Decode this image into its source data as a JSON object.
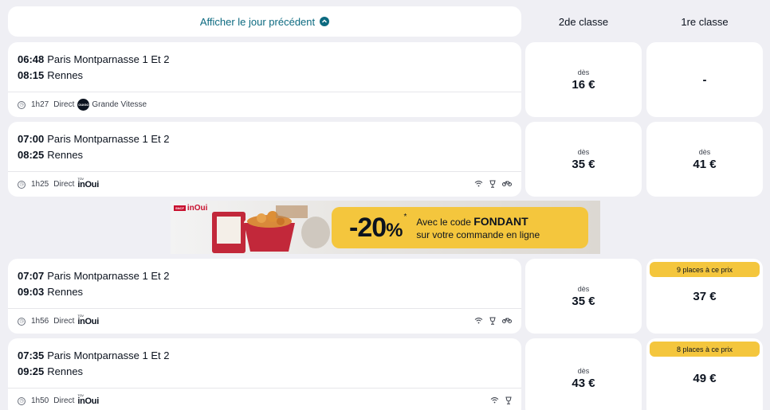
{
  "prev_day": {
    "label": "Afficher le jour précédent"
  },
  "headers": {
    "second_class": "2de classe",
    "first_class": "1re classe"
  },
  "journeys": [
    {
      "dep_time": "06:48",
      "dep_station": "Paris Montparnasse 1 Et 2",
      "arr_time": "08:15",
      "arr_station": "Rennes",
      "duration": "1h27",
      "type": "Direct",
      "brand": "Grande Vitesse",
      "brand_logo_text": "OUIGO",
      "amenities": [],
      "second": {
        "from": "dès",
        "price": "16 €"
      },
      "first": {
        "from": "",
        "price": "-",
        "badge": ""
      }
    },
    {
      "dep_time": "07:00",
      "dep_station": "Paris Montparnasse 1 Et 2",
      "arr_time": "08:25",
      "arr_station": "Rennes",
      "duration": "1h25",
      "type": "Direct",
      "brand": "inOui",
      "brand_tag": "TGV",
      "amenities": [
        "wifi-icon",
        "bar-icon",
        "bike-icon"
      ],
      "second": {
        "from": "dès",
        "price": "35 €"
      },
      "first": {
        "from": "dès",
        "price": "41 €",
        "badge": ""
      }
    },
    {
      "dep_time": "07:07",
      "dep_station": "Paris Montparnasse 1 Et 2",
      "arr_time": "09:03",
      "arr_station": "Rennes",
      "duration": "1h56",
      "type": "Direct",
      "brand": "inOui",
      "brand_tag": "TGV",
      "amenities": [
        "wifi-icon",
        "bar-icon",
        "bike-icon"
      ],
      "second": {
        "from": "dès",
        "price": "35 €"
      },
      "first": {
        "from": "",
        "price": "37 €",
        "badge": "9 places à ce prix"
      }
    },
    {
      "dep_time": "07:35",
      "dep_station": "Paris Montparnasse 1 Et 2",
      "arr_time": "09:25",
      "arr_station": "Rennes",
      "duration": "1h50",
      "type": "Direct",
      "brand": "inOui",
      "brand_tag": "TGV",
      "amenities": [
        "wifi-icon",
        "bar-icon"
      ],
      "second": {
        "from": "dès",
        "price": "43 €"
      },
      "first": {
        "from": "",
        "price": "49 €",
        "badge": "8 places à ce prix"
      }
    }
  ],
  "ad": {
    "logo_sncf": "SNCF",
    "logo_brand": "inOui",
    "discount": "-20",
    "percent": "%",
    "asterisk": "*",
    "line1_pre": "Avec le code ",
    "code": "FONDANT",
    "line2": "sur votre commande en ligne"
  },
  "colors": {
    "accent": "#0c6a80",
    "badge": "#f4c63d",
    "background": "#efeff4"
  }
}
